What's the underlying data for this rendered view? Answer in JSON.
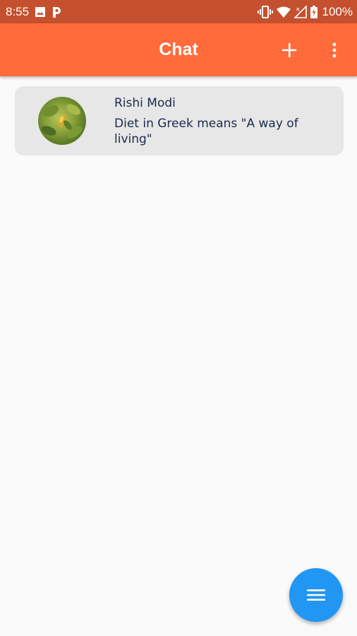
{
  "status_bar": {
    "time": "8:55",
    "battery": "100%",
    "left_icons": [
      "image-icon",
      "p-icon"
    ],
    "right_icons": [
      "vibrate-icon",
      "wifi-icon",
      "signal-icon",
      "battery-icon"
    ]
  },
  "app_bar": {
    "title": "Chat",
    "actions": [
      "add-icon",
      "more-vert-icon"
    ],
    "color": "#ff6b3b"
  },
  "chats": [
    {
      "name": "Rishi Modi",
      "message": "Diet in Greek means \"A way of living\""
    }
  ],
  "fab": {
    "icon": "menu-icon",
    "color": "#2196f3"
  },
  "colors": {
    "status_bar": "#c4502e",
    "app_bar": "#ff6b3b",
    "background": "#fafafa",
    "card": "#e7e7e7",
    "text": "#1b2a4a",
    "fab": "#2196f3"
  }
}
